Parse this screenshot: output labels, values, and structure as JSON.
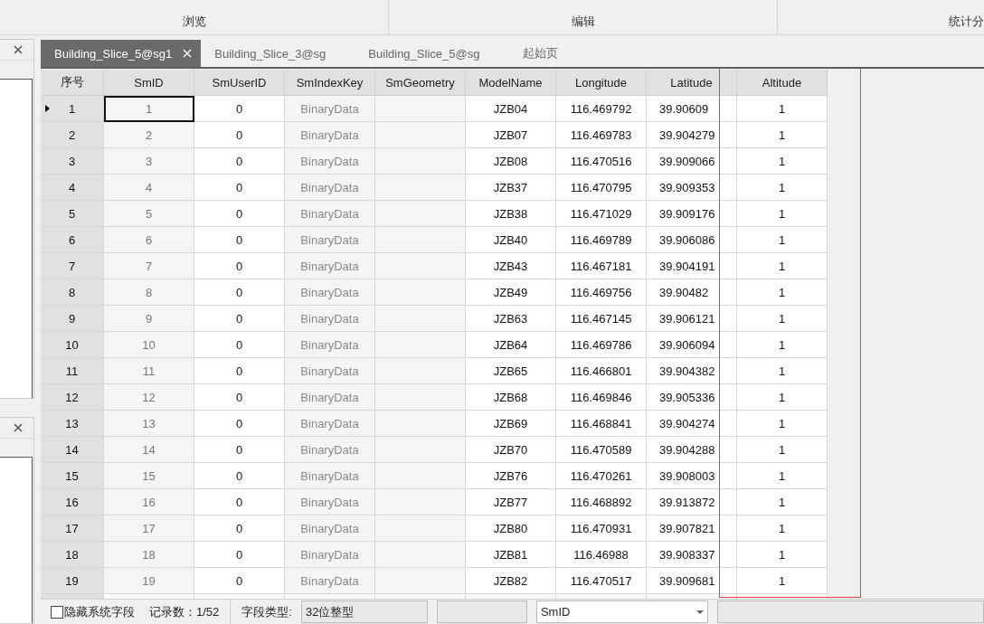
{
  "ribbon": {
    "groups": [
      "浏览",
      "编辑",
      "统计分"
    ]
  },
  "doc_tabs": [
    {
      "label": "Building_Slice_5@sg1",
      "selected": true,
      "closable": true
    },
    {
      "label": "Building_Slice_3@sg",
      "selected": false,
      "closable": false
    },
    {
      "label": "Building_Slice_5@sg",
      "selected": false,
      "closable": false
    },
    {
      "label": "起始页",
      "selected": false,
      "closable": false
    }
  ],
  "table": {
    "columns": [
      "序号",
      "SmID",
      "SmUserID",
      "SmIndexKey",
      "SmGeometry",
      "ModelName",
      "Longitude",
      "Latitude",
      "Altitude"
    ],
    "rows": [
      {
        "n": "1",
        "id": "1",
        "uid": "0",
        "key": "BinaryData",
        "model": "JZB04",
        "lon": "116.469792",
        "lat": "39.90609",
        "alt": "1",
        "selected": true
      },
      {
        "n": "2",
        "id": "2",
        "uid": "0",
        "key": "BinaryData",
        "model": "JZB07",
        "lon": "116.469783",
        "lat": "39.904279",
        "alt": "1",
        "selected": false
      },
      {
        "n": "3",
        "id": "3",
        "uid": "0",
        "key": "BinaryData",
        "model": "JZB08",
        "lon": "116.470516",
        "lat": "39.909066",
        "alt": "1",
        "selected": false
      },
      {
        "n": "4",
        "id": "4",
        "uid": "0",
        "key": "BinaryData",
        "model": "JZB37",
        "lon": "116.470795",
        "lat": "39.909353",
        "alt": "1",
        "selected": false
      },
      {
        "n": "5",
        "id": "5",
        "uid": "0",
        "key": "BinaryData",
        "model": "JZB38",
        "lon": "116.471029",
        "lat": "39.909176",
        "alt": "1",
        "selected": false
      },
      {
        "n": "6",
        "id": "6",
        "uid": "0",
        "key": "BinaryData",
        "model": "JZB40",
        "lon": "116.469789",
        "lat": "39.906086",
        "alt": "1",
        "selected": false
      },
      {
        "n": "7",
        "id": "7",
        "uid": "0",
        "key": "BinaryData",
        "model": "JZB43",
        "lon": "116.467181",
        "lat": "39.904191",
        "alt": "1",
        "selected": false
      },
      {
        "n": "8",
        "id": "8",
        "uid": "0",
        "key": "BinaryData",
        "model": "JZB49",
        "lon": "116.469756",
        "lat": "39.90482",
        "alt": "1",
        "selected": false
      },
      {
        "n": "9",
        "id": "9",
        "uid": "0",
        "key": "BinaryData",
        "model": "JZB63",
        "lon": "116.467145",
        "lat": "39.906121",
        "alt": "1",
        "selected": false
      },
      {
        "n": "10",
        "id": "10",
        "uid": "0",
        "key": "BinaryData",
        "model": "JZB64",
        "lon": "116.469786",
        "lat": "39.906094",
        "alt": "1",
        "selected": false
      },
      {
        "n": "11",
        "id": "11",
        "uid": "0",
        "key": "BinaryData",
        "model": "JZB65",
        "lon": "116.466801",
        "lat": "39.904382",
        "alt": "1",
        "selected": false
      },
      {
        "n": "12",
        "id": "12",
        "uid": "0",
        "key": "BinaryData",
        "model": "JZB68",
        "lon": "116.469846",
        "lat": "39.905336",
        "alt": "1",
        "selected": false
      },
      {
        "n": "13",
        "id": "13",
        "uid": "0",
        "key": "BinaryData",
        "model": "JZB69",
        "lon": "116.468841",
        "lat": "39.904274",
        "alt": "1",
        "selected": false
      },
      {
        "n": "14",
        "id": "14",
        "uid": "0",
        "key": "BinaryData",
        "model": "JZB70",
        "lon": "116.470589",
        "lat": "39.904288",
        "alt": "1",
        "selected": false
      },
      {
        "n": "15",
        "id": "15",
        "uid": "0",
        "key": "BinaryData",
        "model": "JZB76",
        "lon": "116.470261",
        "lat": "39.908003",
        "alt": "1",
        "selected": false
      },
      {
        "n": "16",
        "id": "16",
        "uid": "0",
        "key": "BinaryData",
        "model": "JZB77",
        "lon": "116.468892",
        "lat": "39.913872",
        "alt": "1",
        "selected": false
      },
      {
        "n": "17",
        "id": "17",
        "uid": "0",
        "key": "BinaryData",
        "model": "JZB80",
        "lon": "116.470931",
        "lat": "39.907821",
        "alt": "1",
        "selected": false
      },
      {
        "n": "18",
        "id": "18",
        "uid": "0",
        "key": "BinaryData",
        "model": "JZB81",
        "lon": "116.46988",
        "lat": "39.908337",
        "alt": "1",
        "selected": false
      },
      {
        "n": "19",
        "id": "19",
        "uid": "0",
        "key": "BinaryData",
        "model": "JZB82",
        "lon": "116.470517",
        "lat": "39.909681",
        "alt": "1",
        "selected": false
      }
    ]
  },
  "status_bar": {
    "hide_system_fields": {
      "label": "隐藏系统字段",
      "checked": false
    },
    "record_count": "记录数：1/52",
    "field_type_label": "字段类型:",
    "field_type": "32位整型",
    "field_select": "SmID"
  }
}
